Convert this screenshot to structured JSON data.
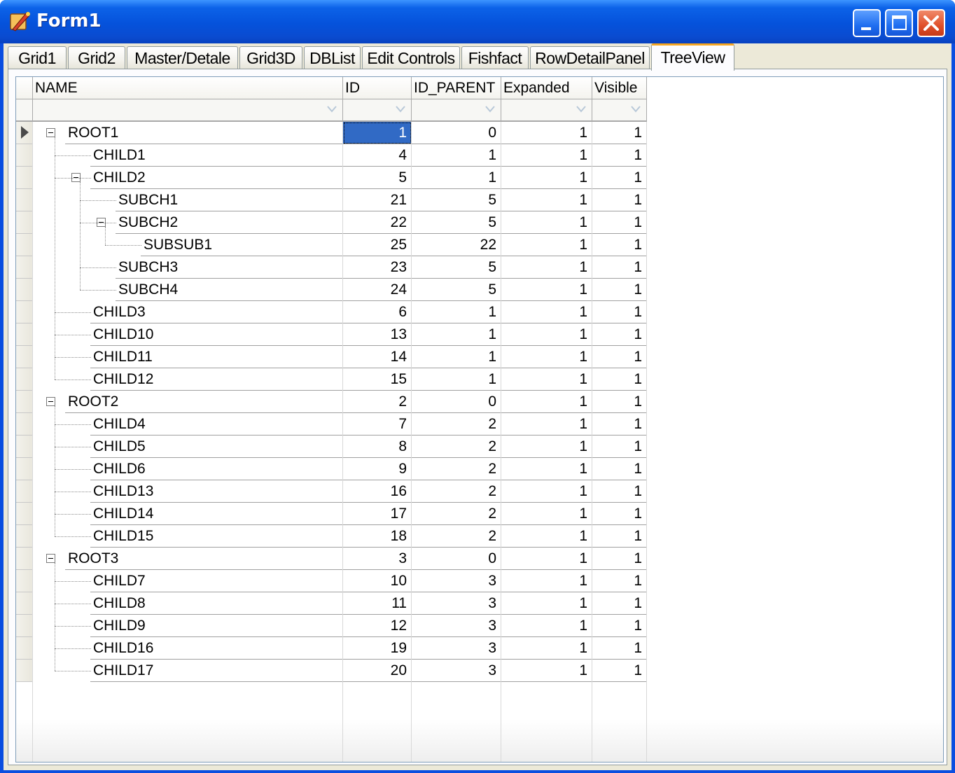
{
  "window": {
    "title": "Form1"
  },
  "tabs": [
    "Grid1",
    "Grid2",
    "Master/Detale",
    "Grid3D",
    "DBList",
    "Edit Controls",
    "Fishfact",
    "RowDetailPanel",
    "TreeView"
  ],
  "active_tab": "TreeView",
  "grid": {
    "columns": [
      "NAME",
      "ID",
      "ID_PARENT",
      "Expanded",
      "Visible"
    ],
    "rows": [
      {
        "name": "ROOT1",
        "level": 0,
        "expandable": true,
        "id": "1",
        "id_parent": "0",
        "expanded": "1",
        "visible": "1"
      },
      {
        "name": "CHILD1",
        "level": 1,
        "expandable": false,
        "id": "4",
        "id_parent": "1",
        "expanded": "1",
        "visible": "1"
      },
      {
        "name": "CHILD2",
        "level": 1,
        "expandable": true,
        "id": "5",
        "id_parent": "1",
        "expanded": "1",
        "visible": "1"
      },
      {
        "name": "SUBCH1",
        "level": 2,
        "expandable": false,
        "id": "21",
        "id_parent": "5",
        "expanded": "1",
        "visible": "1"
      },
      {
        "name": "SUBCH2",
        "level": 2,
        "expandable": true,
        "id": "22",
        "id_parent": "5",
        "expanded": "1",
        "visible": "1"
      },
      {
        "name": "SUBSUB1",
        "level": 3,
        "expandable": false,
        "id": "25",
        "id_parent": "22",
        "expanded": "1",
        "visible": "1"
      },
      {
        "name": "SUBCH3",
        "level": 2,
        "expandable": false,
        "id": "23",
        "id_parent": "5",
        "expanded": "1",
        "visible": "1"
      },
      {
        "name": "SUBCH4",
        "level": 2,
        "expandable": false,
        "id": "24",
        "id_parent": "5",
        "expanded": "1",
        "visible": "1"
      },
      {
        "name": "CHILD3",
        "level": 1,
        "expandable": false,
        "id": "6",
        "id_parent": "1",
        "expanded": "1",
        "visible": "1"
      },
      {
        "name": "CHILD10",
        "level": 1,
        "expandable": false,
        "id": "13",
        "id_parent": "1",
        "expanded": "1",
        "visible": "1"
      },
      {
        "name": "CHILD11",
        "level": 1,
        "expandable": false,
        "id": "14",
        "id_parent": "1",
        "expanded": "1",
        "visible": "1"
      },
      {
        "name": "CHILD12",
        "level": 1,
        "expandable": false,
        "id": "15",
        "id_parent": "1",
        "expanded": "1",
        "visible": "1"
      },
      {
        "name": "ROOT2",
        "level": 0,
        "expandable": true,
        "id": "2",
        "id_parent": "0",
        "expanded": "1",
        "visible": "1"
      },
      {
        "name": "CHILD4",
        "level": 1,
        "expandable": false,
        "id": "7",
        "id_parent": "2",
        "expanded": "1",
        "visible": "1"
      },
      {
        "name": "CHILD5",
        "level": 1,
        "expandable": false,
        "id": "8",
        "id_parent": "2",
        "expanded": "1",
        "visible": "1"
      },
      {
        "name": "CHILD6",
        "level": 1,
        "expandable": false,
        "id": "9",
        "id_parent": "2",
        "expanded": "1",
        "visible": "1"
      },
      {
        "name": "CHILD13",
        "level": 1,
        "expandable": false,
        "id": "16",
        "id_parent": "2",
        "expanded": "1",
        "visible": "1"
      },
      {
        "name": "CHILD14",
        "level": 1,
        "expandable": false,
        "id": "17",
        "id_parent": "2",
        "expanded": "1",
        "visible": "1"
      },
      {
        "name": "CHILD15",
        "level": 1,
        "expandable": false,
        "id": "18",
        "id_parent": "2",
        "expanded": "1",
        "visible": "1"
      },
      {
        "name": "ROOT3",
        "level": 0,
        "expandable": true,
        "id": "3",
        "id_parent": "0",
        "expanded": "1",
        "visible": "1"
      },
      {
        "name": "CHILD7",
        "level": 1,
        "expandable": false,
        "id": "10",
        "id_parent": "3",
        "expanded": "1",
        "visible": "1"
      },
      {
        "name": "CHILD8",
        "level": 1,
        "expandable": false,
        "id": "11",
        "id_parent": "3",
        "expanded": "1",
        "visible": "1"
      },
      {
        "name": "CHILD9",
        "level": 1,
        "expandable": false,
        "id": "12",
        "id_parent": "3",
        "expanded": "1",
        "visible": "1"
      },
      {
        "name": "CHILD16",
        "level": 1,
        "expandable": false,
        "id": "19",
        "id_parent": "3",
        "expanded": "1",
        "visible": "1"
      },
      {
        "name": "CHILD17",
        "level": 1,
        "expandable": false,
        "id": "20",
        "id_parent": "3",
        "expanded": "1",
        "visible": "1"
      }
    ]
  },
  "colors": {
    "titlebar": "#0552db",
    "selection": "#316ac5",
    "active_tab_accent": "#f5a623"
  },
  "icons": [
    "app-icon",
    "minimize-icon",
    "maximize-icon",
    "close-icon",
    "filter-dropdown-icon",
    "current-row-indicator-icon",
    "collapse-icon"
  ]
}
